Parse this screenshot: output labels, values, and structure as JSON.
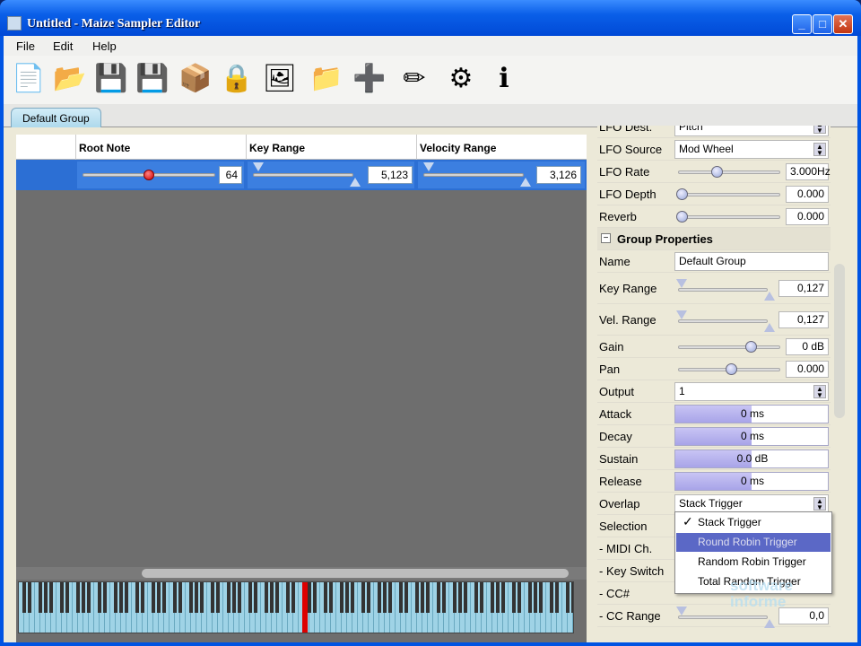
{
  "window": {
    "title": "Untitled - Maize Sampler Editor",
    "minimize": "_",
    "maximize": "□",
    "close": "✕"
  },
  "menu": [
    "File",
    "Edit",
    "Help"
  ],
  "toolbar": [
    {
      "name": "new-file-icon",
      "glyph": "📄"
    },
    {
      "name": "open-folder-icon",
      "glyph": "📂"
    },
    {
      "name": "save-icon",
      "glyph": "💾"
    },
    {
      "name": "save-as-icon",
      "glyph": "💾"
    },
    {
      "name": "import-icon",
      "glyph": "📦"
    },
    {
      "name": "lock-icon",
      "glyph": "🔒"
    },
    {
      "name": "image-icon",
      "glyph": "🖼"
    },
    {
      "name": "folder-icon",
      "glyph": "📁"
    },
    {
      "name": "add-icon",
      "glyph": "➕"
    },
    {
      "name": "pencil-icon",
      "glyph": "✏"
    },
    {
      "name": "settings-gear-icon",
      "glyph": "⚙"
    },
    {
      "name": "info-icon",
      "glyph": "ℹ"
    }
  ],
  "tab": {
    "label": "Default Group"
  },
  "grid": {
    "headers": [
      "Root Note",
      "Key Range",
      "Velocity Range"
    ],
    "row": {
      "root_note": "64",
      "key_range": "5,123",
      "velocity_range": "3,126"
    }
  },
  "properties": {
    "lfo_dest_label": "LFO Dest.",
    "lfo_dest_value": "Pitch",
    "lfo_source_label": "LFO Source",
    "lfo_source_value": "Mod Wheel",
    "lfo_rate_label": "LFO Rate",
    "lfo_rate_value": "3.000Hz",
    "lfo_depth_label": "LFO Depth",
    "lfo_depth_value": "0.000",
    "reverb_label": "Reverb",
    "reverb_value": "0.000",
    "group_section_title": "Group Properties",
    "collapse_glyph": "−",
    "name_label": "Name",
    "name_value": "Default Group",
    "key_range_label": "Key Range",
    "key_range_value": "0,127",
    "vel_range_label": "Vel. Range",
    "vel_range_value": "0,127",
    "gain_label": "Gain",
    "gain_value": "0 dB",
    "pan_label": "Pan",
    "pan_value": "0.000",
    "output_label": "Output",
    "output_value": "1",
    "attack_label": "Attack",
    "attack_value": "0 ms",
    "decay_label": "Decay",
    "decay_value": "0 ms",
    "sustain_label": "Sustain",
    "sustain_value": "0.0 dB",
    "release_label": "Release",
    "release_value": "0 ms",
    "overlap_label": "Overlap",
    "overlap_value": "Stack Trigger",
    "selection_label": "Selection",
    "midi_ch_label": "- MIDI Ch.",
    "key_switch_label": "- Key Switch",
    "cc_label": "- CC#",
    "cc_range_label": "- CC Range",
    "cc_range_value": "0,0"
  },
  "slider_levels": {
    "lfo_rate": 0.35,
    "lfo_depth": 0,
    "reverb": 0,
    "gain": 0.7,
    "pan": 0.5,
    "root_note": 0.5
  },
  "fill_levels": {
    "attack": 0.5,
    "decay": 0.5,
    "sustain": 0.5,
    "release": 0.5
  },
  "overlap_menu": {
    "items": [
      "Stack Trigger",
      "Round Robin Trigger",
      "Random Robin Trigger",
      "Total Random Trigger"
    ],
    "selected": "Stack Trigger",
    "hover": "Round Robin Trigger",
    "check": "✓"
  },
  "watermark": "software\ninforme"
}
